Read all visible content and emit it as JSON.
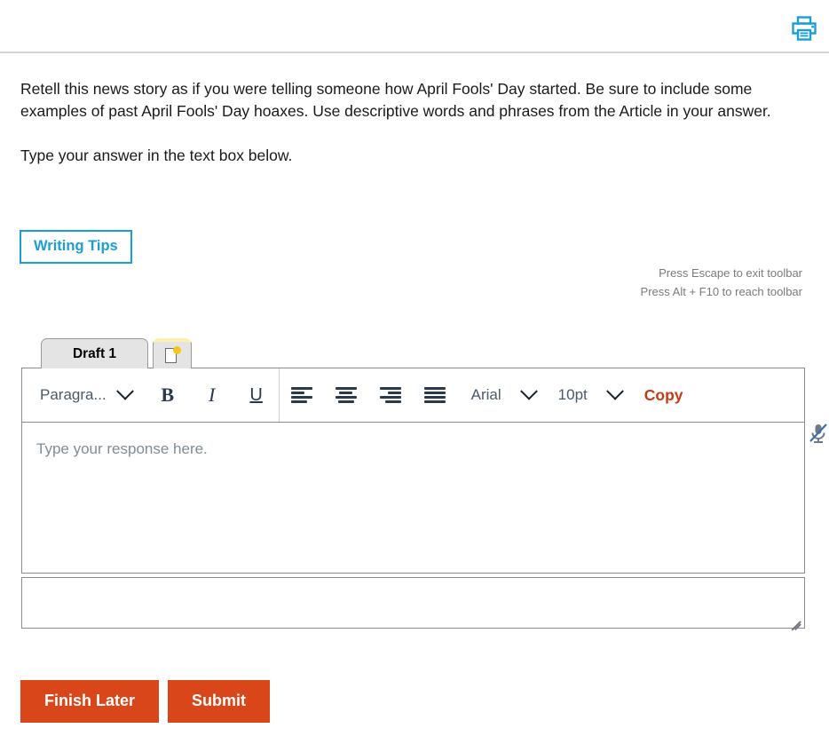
{
  "topbar": {
    "print_icon": "printer-icon",
    "print_title": "Print"
  },
  "prompt": {
    "paragraph1": "Retell this news story as if you were telling someone how April Fools' Day started. Be sure to include some examples of past April Fools' Day hoaxes. Use descriptive words and phrases from the Article in your answer.",
    "paragraph2": "Type your answer in the text box below."
  },
  "writing_tips": {
    "label": "Writing Tips",
    "border_color": "#1a9ed4",
    "text_color": "#1a9ed4"
  },
  "hints": {
    "line1": "Press Escape to exit toolbar",
    "line2": "Press Alt + F10 to reach toolbar"
  },
  "tabs": {
    "draft_label": "Draft 1",
    "new_tab_icon": "new-page-icon"
  },
  "toolbar": {
    "format_label": "Paragra...",
    "bold_label": "B",
    "italic_label": "I",
    "underline_label": "U",
    "align_left_icon": "align-left-icon",
    "align_center_icon": "align-center-icon",
    "align_right_icon": "align-right-icon",
    "align_justify_icon": "align-justify-icon",
    "font_name": "Arial",
    "font_size": "10pt",
    "copy_label": "Copy",
    "copy_color": "#c43c13",
    "chevron_icon": "chevron-down-icon"
  },
  "editor": {
    "placeholder": "Type your response here.",
    "value": "",
    "mic_icon": "microphone-muted-icon",
    "resize_icon": "resize-grip-icon"
  },
  "actions": {
    "finish_later": "Finish Later",
    "submit": "Submit",
    "button_color": "#d9461a"
  }
}
